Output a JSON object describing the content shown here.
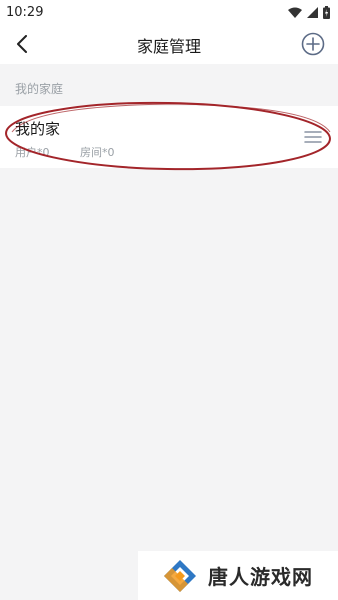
{
  "status_bar": {
    "time": "10:29",
    "icons": [
      "wifi-icon",
      "signal-icon",
      "battery-icon"
    ]
  },
  "header": {
    "back_icon": "chevron-left-icon",
    "title": "家庭管理",
    "add_icon": "plus-circle-icon"
  },
  "section": {
    "label": "我的家庭"
  },
  "homes": [
    {
      "name": "我的家",
      "users": "用户*0",
      "rooms": "房间*0",
      "handle_icon": "drag-handle-icon"
    }
  ],
  "annotation": {
    "color": "#a3252a"
  },
  "watermark": {
    "text": "唐人游戏网",
    "logo_colors": [
      "#2f78c4",
      "#f39a1e"
    ]
  },
  "colors": {
    "background": "#f4f4f5",
    "surface": "#ffffff",
    "text_primary": "#1a1a1a",
    "text_secondary": "#9aa0a6",
    "accent": "#5c6b86"
  }
}
